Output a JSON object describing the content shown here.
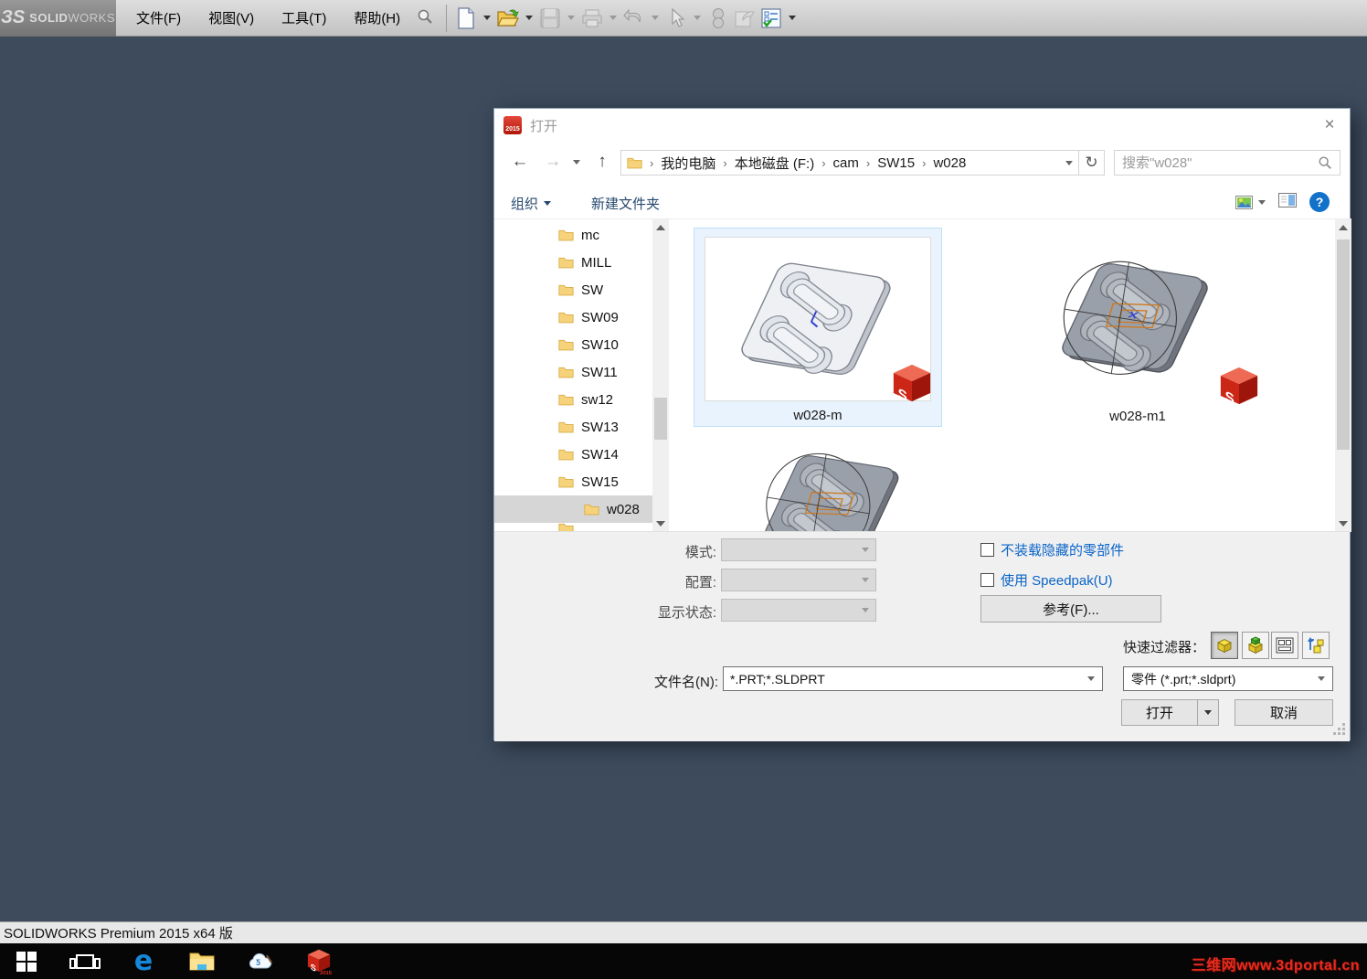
{
  "colors": {
    "sw_red": "#cf2a1b",
    "link_blue": "#0a64c8",
    "viewport_dark": "#3d4b5d",
    "selection_bg": "#e9f3fd",
    "selection_border": "#bee0f8"
  },
  "icons": {
    "back": "←",
    "forward": "→",
    "up": "↑",
    "refresh": "↻",
    "close": "×",
    "help": "?",
    "breadcrumb_sep": "›"
  },
  "app": {
    "logo_glyph": "ЗS",
    "logo_solid": "SOLID",
    "logo_works": "WORKS",
    "menu": [
      "文件(F)",
      "视图(V)",
      "工具(T)",
      "帮助(H)"
    ],
    "statusbar": "SOLIDWORKS Premium 2015 x64 版"
  },
  "dialog": {
    "title": "打开",
    "title_icon_year": "2015",
    "breadcrumb": [
      "我的电脑",
      "本地磁盘 (F:)",
      "cam",
      "SW15",
      "w028"
    ],
    "search_placeholder": "搜索\"w028\"",
    "commands": {
      "organize": "组织",
      "new_folder": "新建文件夹"
    },
    "tree": [
      "mc",
      "MILL",
      "SW",
      "SW09",
      "SW10",
      "SW11",
      "sw12",
      "SW13",
      "SW14",
      "SW15",
      "w028"
    ],
    "files": [
      {
        "name": "w028-m"
      },
      {
        "name": "w028-m1"
      }
    ],
    "options": {
      "mode_label": "模式:",
      "config_label": "配置:",
      "display_label": "显示状态:",
      "chk_hidden": "不装载隐藏的零部件",
      "chk_speedpak": "使用 Speedpak(U)",
      "references": "参考(F)...",
      "quick_filter": "快速过滤器："
    },
    "filename": {
      "label": "文件名(N):",
      "value": "*.PRT;*.SLDPRT",
      "filetype": "零件 (*.prt;*.sldprt)"
    },
    "buttons": {
      "open": "打开",
      "cancel": "取消"
    }
  },
  "taskbar": {
    "watermark": "三维网www.3dportal.cn"
  }
}
